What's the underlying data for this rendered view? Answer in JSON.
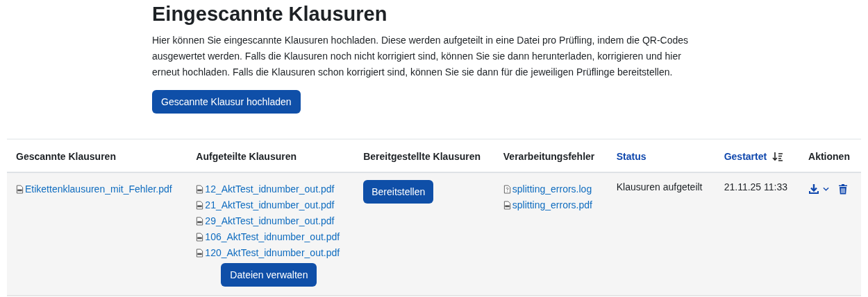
{
  "heading": "Eingescannte Klausuren",
  "description": "Hier können Sie eingescannte Klausuren hochladen. Diese werden aufgeteilt in eine Datei pro Prüfling, indem die QR-Codes ausgewertet werden. Falls die Klausuren noch nicht korrigiert sind, können Sie sie dann herunterladen, korrigieren und hier erneut hochladen. Falls die Klausuren schon korrigiert sind, können Sie sie dann für die jeweiligen Prüflinge bereitstellen.",
  "upload_button": "Gescannte Klausur hochladen",
  "table": {
    "columns": [
      {
        "label": "Gescannte Klausuren",
        "sortable": false,
        "sorted": false
      },
      {
        "label": "Aufgeteilte Klausuren",
        "sortable": false,
        "sorted": false
      },
      {
        "label": "Bereitgestellte Klausuren",
        "sortable": false,
        "sorted": false
      },
      {
        "label": "Verarbeitungsfehler",
        "sortable": false,
        "sorted": false
      },
      {
        "label": "Status",
        "sortable": true,
        "sorted": false
      },
      {
        "label": "Gestartet",
        "sortable": true,
        "sorted": true
      },
      {
        "label": "Aktionen",
        "sortable": false,
        "sorted": false
      }
    ],
    "rows": [
      {
        "scanned_file": {
          "name": "Etikettenklausuren_mit_Fehler.pdf",
          "kind": "pdf"
        },
        "split_files": [
          {
            "name": "12_AktTest_idnumber_out.pdf",
            "kind": "pdf"
          },
          {
            "name": "21_AktTest_idnumber_out.pdf",
            "kind": "pdf"
          },
          {
            "name": "29_AktTest_idnumber_out.pdf",
            "kind": "pdf"
          },
          {
            "name": "106_AktTest_idnumber_out.pdf",
            "kind": "pdf"
          },
          {
            "name": "120_AktTest_idnumber_out.pdf",
            "kind": "pdf"
          }
        ],
        "manage_button": "Dateien verwalten",
        "provide_button": "Bereitstellen",
        "error_files": [
          {
            "name": "splitting_errors.log",
            "kind": "log"
          },
          {
            "name": "splitting_errors.pdf",
            "kind": "pdf"
          }
        ],
        "status": "Klausuren aufgeteilt",
        "started": "21.11.25 11:33"
      }
    ]
  }
}
